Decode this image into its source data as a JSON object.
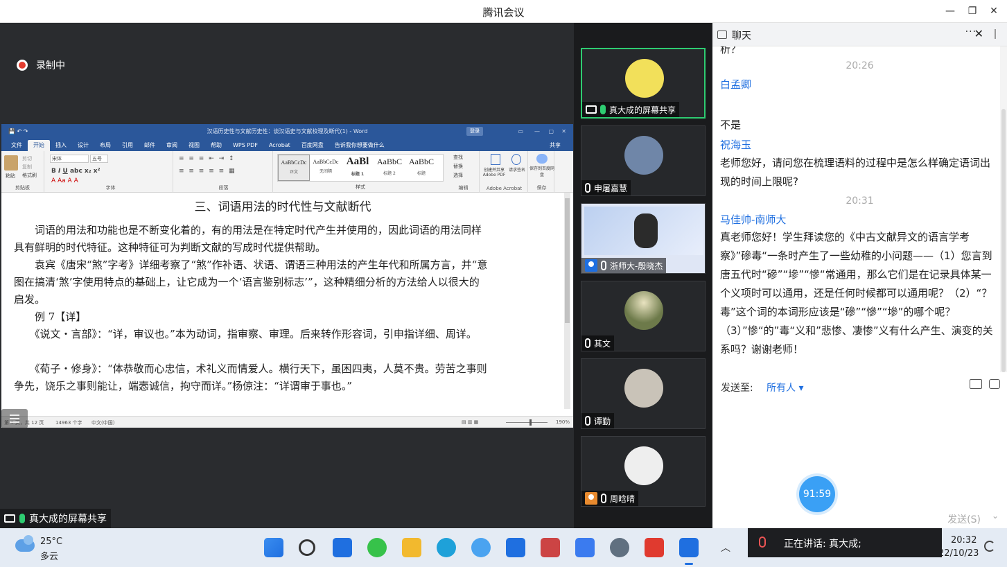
{
  "window": {
    "title": "腾讯会议"
  },
  "recording": {
    "label": "录制中"
  },
  "share": {
    "label": "真大成的屏幕共享"
  },
  "word": {
    "title": "汉语历史性与文献历史性：谈汉语史与文献校理及断代(1) - Word",
    "login": "登录",
    "menu": [
      "文件",
      "开始",
      "插入",
      "设计",
      "布局",
      "引用",
      "邮件",
      "审阅",
      "视图",
      "帮助",
      "WPS PDF",
      "Acrobat",
      "百度网盘",
      "告诉我你想要做什么"
    ],
    "share_btn": "共享",
    "ribbon": {
      "paste": "粘贴",
      "cut": "剪切",
      "copy": "复制",
      "format_painter": "格式刷",
      "font_name": "宋体",
      "font_size": "五号",
      "groups": [
        "剪贴板",
        "字体",
        "段落",
        "样式",
        "编辑",
        "Adobe Acrobat",
        "保存"
      ],
      "styles": [
        {
          "sample": "AaBbCcDc",
          "name": "正文"
        },
        {
          "sample": "AaBbCcDc",
          "name": "无间隔"
        },
        {
          "sample": "AaBl",
          "name": "标题 1"
        },
        {
          "sample": "AaBbC",
          "name": "标题 2"
        },
        {
          "sample": "AaBbC",
          "name": "标题"
        }
      ],
      "find": "查找",
      "replace": "替换",
      "select": "选择",
      "create_pdf": "创建并共享 Adobe PDF",
      "sign": "请求签名",
      "save_baidu": "保存到百度网盘"
    },
    "doc": {
      "heading": "三、词语用法的时代性与文献断代",
      "paragraphs": [
        "　　词语的用法和功能也是不断变化着的，有的用法是在特定时代产生并使用的，因此词语的用法同样具有鲜明的时代特征。这种特征可为判断文献的写成时代提供帮助。",
        "　　袁宾《唐宋“煞”字考》详细考察了“煞”作补语、状语、谓语三种用法的产生年代和所属方言，并“意图在搞清‘煞’字使用特点的基础上，让它成为一个‘语言鉴别标志’”，这种精细分析的方法给人以很大的启发。",
        "　　例 7【详】",
        "　　《说文・言部》：“详，审议也。”本为动词，指审察、审理。后来转作形容词，引申指详细、周详。",
        "　　《荀子・修身》：“体恭敬而心忠信，术礼义而情爱人。横行天下，虽困四夷，人莫不贵。劳苦之事则争先，饶乐之事则能让，端悫诚信，拘守而详。”杨倞注：“详谓审于事也。”"
      ]
    },
    "status": {
      "page": "第 7 页，共 12 页",
      "words": "14963 个字",
      "lang": "中文(中国)",
      "zoom": "190%"
    }
  },
  "participants": [
    {
      "name": "真大成的屏幕共享",
      "active": true,
      "color": "#f2e05a"
    },
    {
      "name": "申屠嘉慧",
      "active": false,
      "color": "#6f86a8"
    },
    {
      "name": "浙师大-殷晓杰",
      "active": false,
      "color": "#8aa7d6"
    },
    {
      "name": "其文",
      "active": false,
      "color": "#6d7a4a"
    },
    {
      "name": "谭勤",
      "active": false,
      "color": "#c9c3b8"
    },
    {
      "name": "周晗晴",
      "active": false,
      "color": "#eeeeee"
    }
  ],
  "chat": {
    "title": "聊天",
    "top_fragment": "析？",
    "time1": "20:26",
    "m1_name": "白孟卿",
    "m1_text": "不是",
    "m2_name": "祝海玉",
    "m2_text": "老师您好，请问您在梳理语料的过程中是怎么样确定语词出现的时间上限呢?",
    "time2": "20:31",
    "m3_name": "马佳帅-南师大",
    "m3_text": "真老师您好！学生拜读您的《中古文献异文的语言学考察》”磣毒“一条时产生了一些幼稚的小问题——（1）您言到唐五代时“磣”“墋”“慘“常通用，那么它们是在记录具体某一个义项时可以通用，还是任何时候都可以通用呢？（2）“？毒”这个词的本词形应该是“磣”“慘”“墋”的哪个呢？（3）”慘“的”毒“义和”悲惨、凄惨”义有什么产生、演变的关系吗？谢谢老师！",
    "send_to_label": "发送至:",
    "send_to_value": "所有人",
    "timer": "91:59",
    "send": "发送(S)"
  },
  "taskbar": {
    "temp": "25°C",
    "weather": "多云",
    "speaking": "正在讲话: 真大成;",
    "time": "20:32",
    "date": "22/10/23"
  }
}
